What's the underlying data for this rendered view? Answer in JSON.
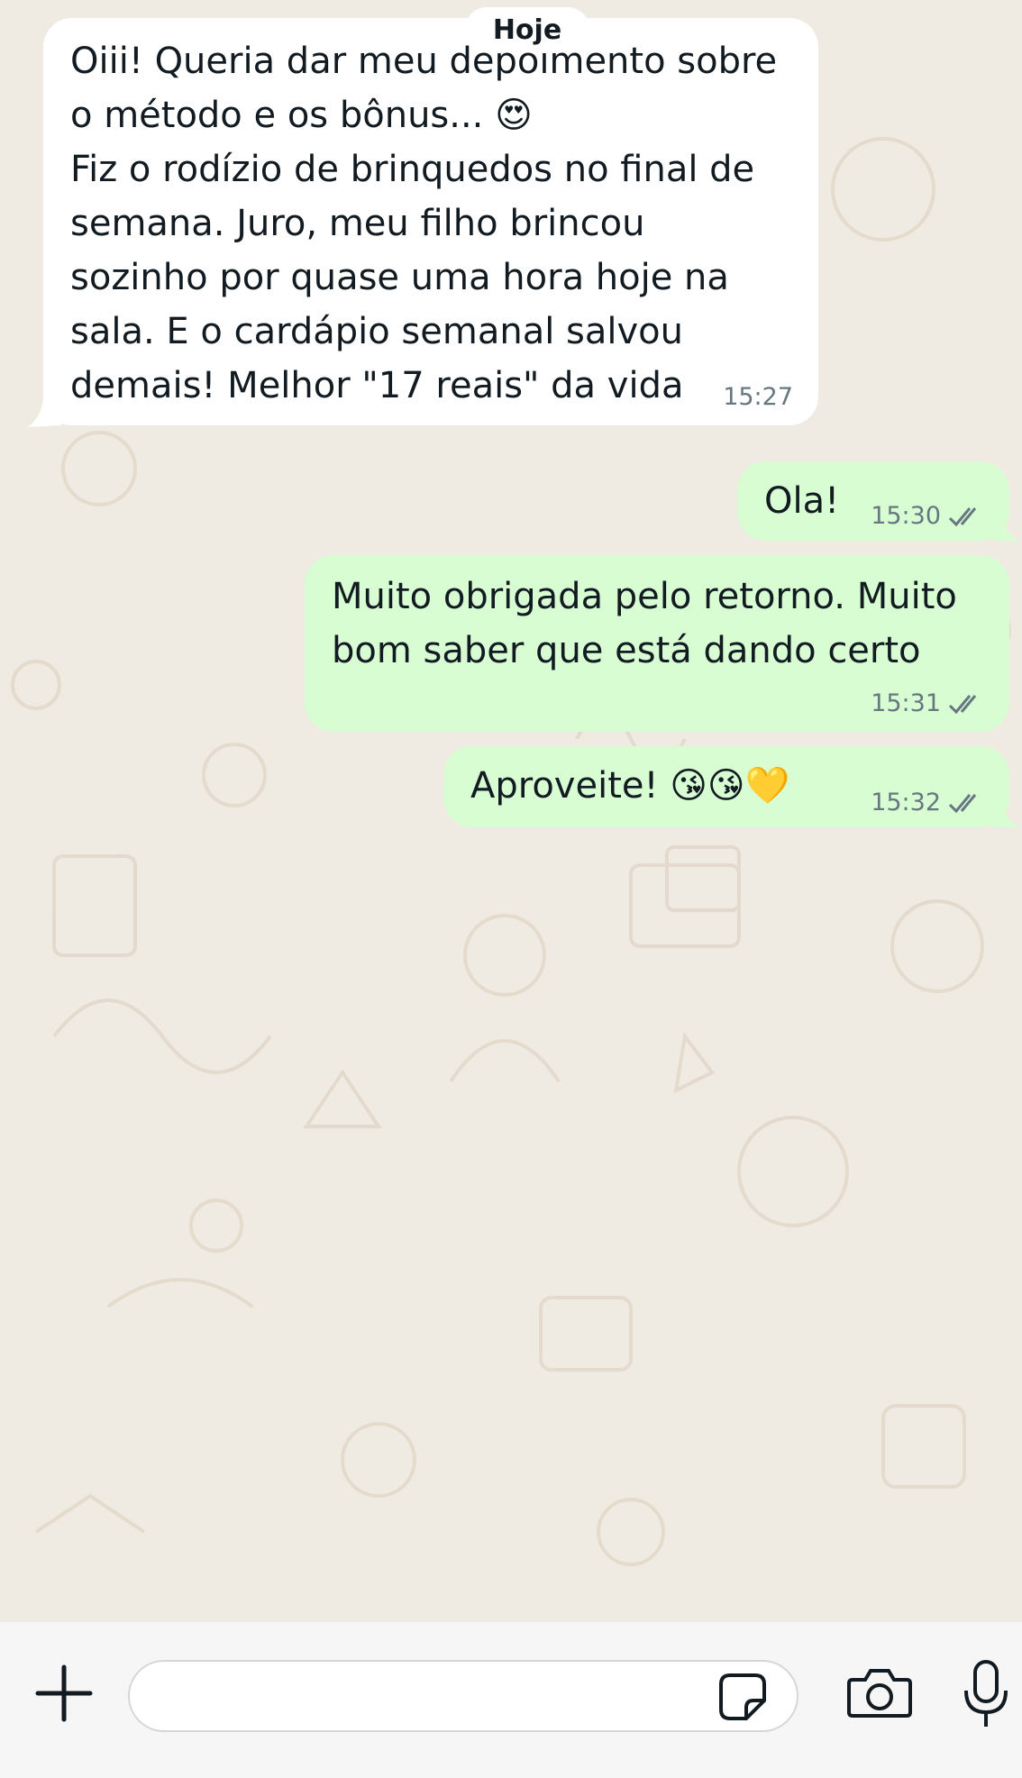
{
  "chat": {
    "date_label": "Hoje",
    "messages": [
      {
        "direction": "in",
        "text": "Oiii! Queria dar meu depoimento sobre\no método e os bônus... 😍\nFiz o rodízio de brinquedos no final de\nsemana. Juro, meu filho brincou\nsozinho por quase uma hora hoje na\nsala. E o cardápio semanal salvou\ndemais! Melhor \"17 reais\" da vida",
        "time": "15:27"
      },
      {
        "direction": "out",
        "text": "Ola!",
        "time": "15:30",
        "status": "read"
      },
      {
        "direction": "out",
        "text": "Muito obrigada pelo retorno. Muito\nbom saber que está dando certo",
        "time": "15:31",
        "status": "read"
      },
      {
        "direction": "out",
        "text": "Aproveite! 😘😘💛",
        "time": "15:32",
        "status": "read"
      }
    ]
  },
  "composer": {
    "icons": [
      "plus-icon",
      "sticker-icon",
      "camera-icon",
      "microphone-icon"
    ]
  },
  "colors": {
    "background": "#efeae2",
    "incoming_bubble": "#ffffff",
    "outgoing_bubble": "#d9fdd3",
    "timestamp": "#667781"
  }
}
